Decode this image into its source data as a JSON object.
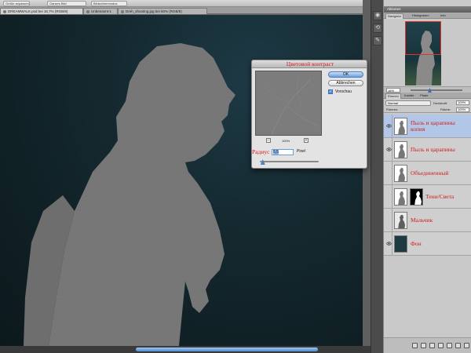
{
  "options_bar": {
    "items": [
      "Größe anpassen",
      "Ganzes Bild",
      "Bildschirmmodus"
    ]
  },
  "tabs": [
    {
      "label": "DREAMWALK.psd bei 16,7% (RGB/8)"
    },
    {
      "label": "Unbenannt-1"
    },
    {
      "label": "Dreh_shooting.jpg bei 50% (RGB/8)"
    }
  ],
  "dialog": {
    "title": "Цветовой контраст",
    "ok_label": "OK",
    "cancel_label": "Abbrechen",
    "preview_label": "Vorschau",
    "preview_checked": true,
    "zoom_out": "–",
    "zoom_in": "+",
    "zoom_percent": "100%",
    "radius_label": "Радиус",
    "radius_value": "5,5",
    "radius_unit": "Pixel",
    "radius_slider_fraction": 0.05
  },
  "navigator": {
    "title": "Aktionen",
    "tabs": [
      "Navigator",
      "Histogramm",
      "Info"
    ],
    "zoom_value": "16%"
  },
  "layers": {
    "tabs": [
      "Ebenen",
      "Kanäle",
      "Pfade"
    ],
    "blend_mode": "Normal",
    "opacity_label": "Deckkraft:",
    "opacity_value": "100%",
    "lock_label": "Fixieren:",
    "fill_label": "Fläche:",
    "fill_value": "100%",
    "items": [
      {
        "name": "Пыль и царапины копия",
        "visible": true,
        "selected": true
      },
      {
        "name": "Пыль и царапины",
        "visible": true,
        "selected": false
      },
      {
        "name": "Объединенный",
        "visible": false,
        "selected": false
      },
      {
        "name": "Тени/Света",
        "visible": false,
        "selected": false
      },
      {
        "name": "Мальчик",
        "visible": false,
        "selected": false
      },
      {
        "name": "Фон",
        "visible": true,
        "selected": false
      }
    ]
  },
  "colors": {
    "layer_label": "#d4191b",
    "selection": "#b2c7e8",
    "accent": "#4e8ad0"
  }
}
